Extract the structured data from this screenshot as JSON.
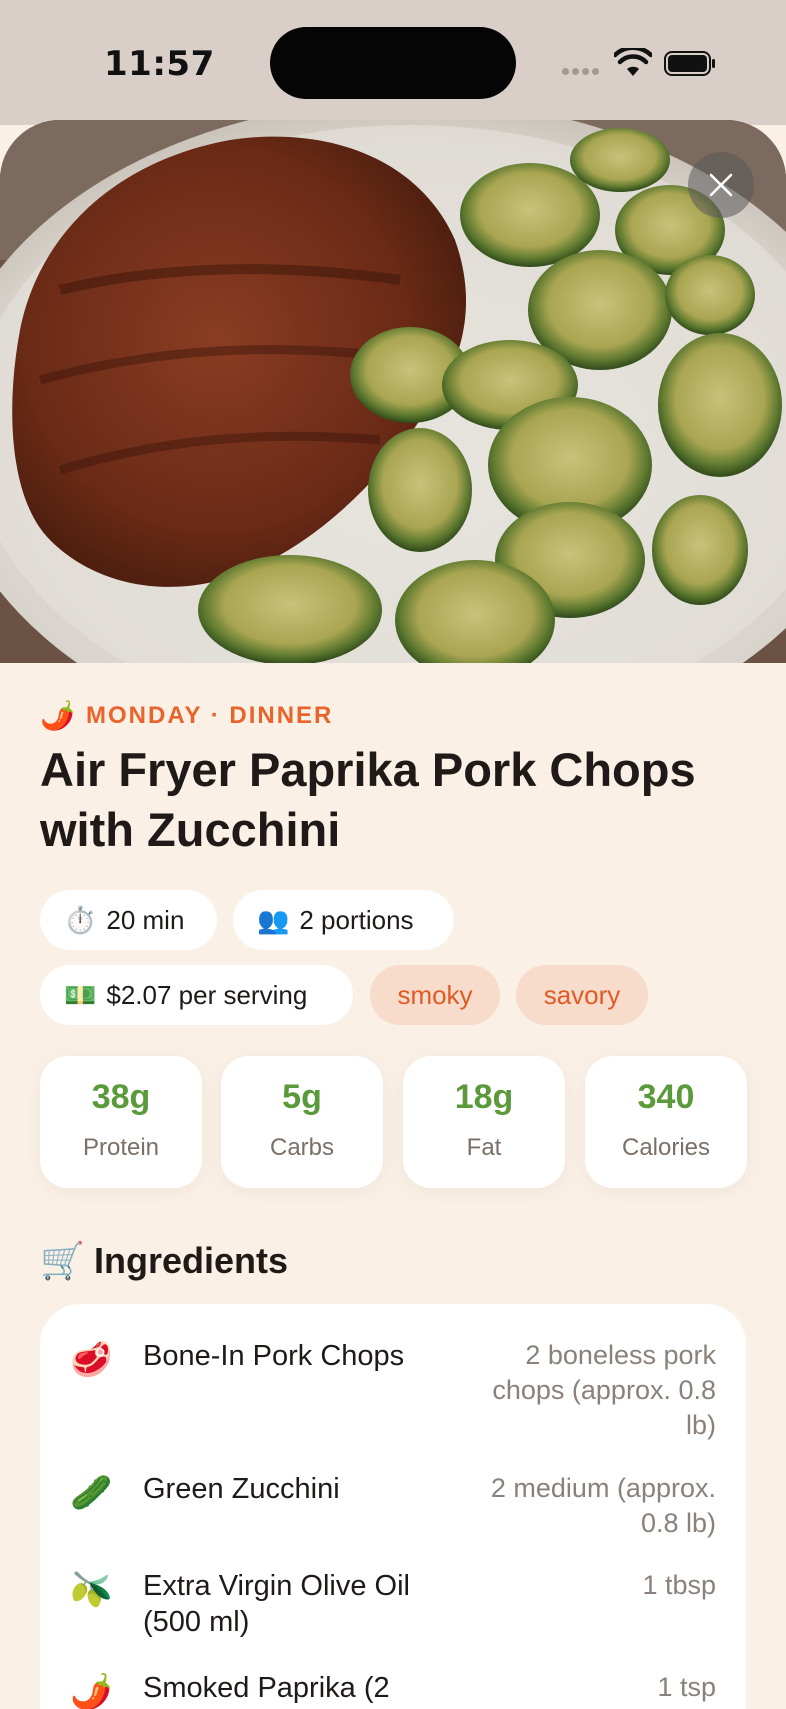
{
  "status_bar": {
    "time": "11:57"
  },
  "hero": {
    "image_description": "plated pork chop with zucchini",
    "close_icon": "close-icon"
  },
  "recipe": {
    "meta_emoji": "🌶️",
    "meta_text": "MONDAY · DINNER",
    "title": "Air Fryer Paprika Pork Chops with Zucchini",
    "chips": [
      {
        "emoji": "⏱️",
        "label": "20 min"
      },
      {
        "emoji": "👥",
        "label": "2 portions"
      },
      {
        "emoji": "💵",
        "label": "$2.07 per serving"
      }
    ],
    "tags": [
      "smoky",
      "savory"
    ],
    "macros": [
      {
        "value": "38g",
        "label": "Protein"
      },
      {
        "value": "5g",
        "label": "Carbs"
      },
      {
        "value": "18g",
        "label": "Fat"
      },
      {
        "value": "340",
        "label": "Calories"
      }
    ]
  },
  "ingredients": {
    "emoji": "🛒",
    "title": "Ingredients",
    "items": [
      {
        "emoji": "🥩",
        "name": "Bone-In Pork Chops",
        "qty": "2 boneless pork chops (approx. 0.8 lb)"
      },
      {
        "emoji": "🥒",
        "name": "Green Zucchini",
        "qty": "2 medium (approx. 0.8 lb)"
      },
      {
        "emoji": "🫒",
        "name": "Extra Virgin Olive Oil (500 ml)",
        "qty": "1 tbsp"
      },
      {
        "emoji": "🌶️",
        "name": "Smoked Paprika (2",
        "qty": "1 tsp"
      }
    ]
  },
  "colors": {
    "accent": "#e8642b",
    "macro_green": "#5a9a3a",
    "background": "#faf0e6",
    "tag_bg": "#f8dccb"
  }
}
